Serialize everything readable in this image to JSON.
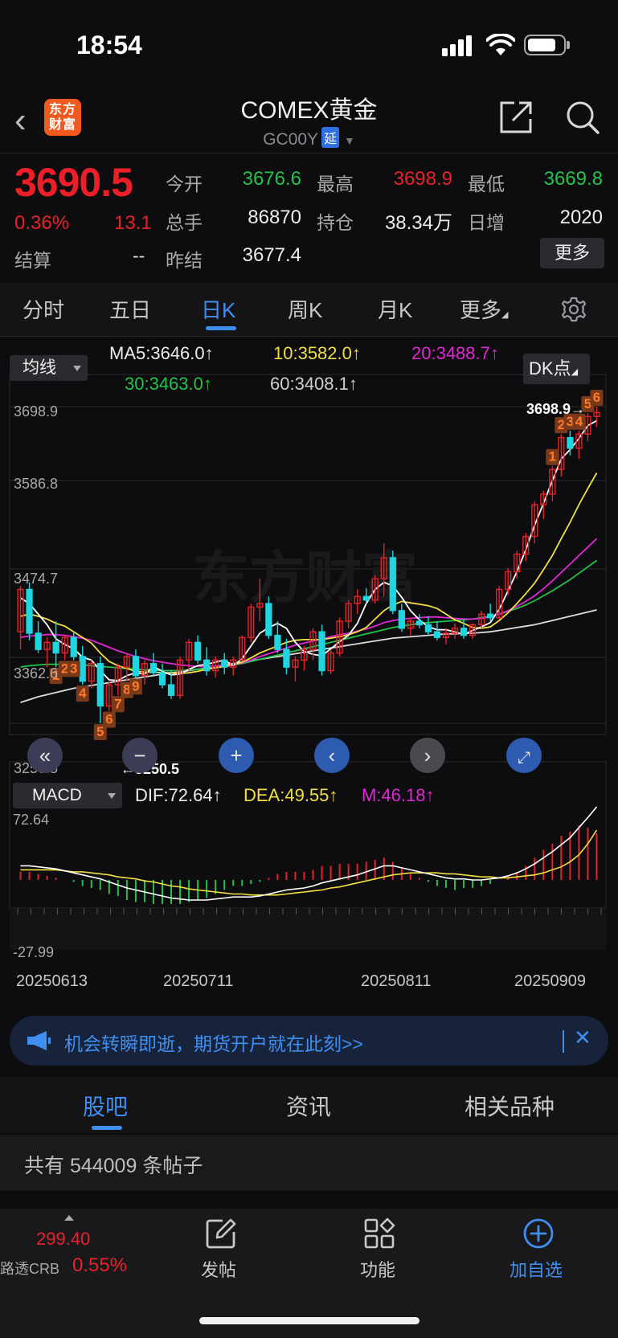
{
  "status_bar": {
    "time": "18:54"
  },
  "header": {
    "logo_line1": "东方",
    "logo_line2": "财富",
    "title": "COMEX黄金",
    "code": "GC00Y",
    "delay_badge": "延"
  },
  "quote": {
    "price": "3690.5",
    "change_pct": "0.36%",
    "change": "13.1",
    "settle_label": "结算",
    "settle_value": "--",
    "open_label": "今开",
    "open_value": "3676.6",
    "high_label": "最高",
    "high_value": "3698.9",
    "low_label": "最低",
    "low_value": "3669.8",
    "volume_label": "总手",
    "volume_value": "86870",
    "oi_label": "持仓",
    "oi_value": "38.34万",
    "daily_inc_label": "日增",
    "daily_inc_value": "2020",
    "prev_settle_label": "昨结",
    "prev_settle_value": "3677.4",
    "more_label": "更多"
  },
  "tabs": [
    "分时",
    "五日",
    "日K",
    "周K",
    "月K",
    "更多"
  ],
  "active_tab": "日K",
  "indicators": {
    "ma_select": "均线",
    "ma5": "MA5:3646.0↑",
    "ma10": "10:3582.0↑",
    "ma20": "20:3488.7↑",
    "ma30": "30:3463.0↑",
    "ma60": "60:3408.1↑",
    "dk_label": "DK点",
    "macd_select": "MACD",
    "dif": "DIF:72.64↑",
    "dea": "DEA:49.55↑",
    "m": "M:46.18↑"
  },
  "axis": {
    "y_labels": [
      "3698.9",
      "3586.8",
      "3474.7",
      "3362.6",
      "3250.5"
    ],
    "max_marker": "3698.9→",
    "min_marker": "←3250.5",
    "macd_top": "72.64",
    "macd_bottom": "-27.99",
    "dates": [
      "20250613",
      "20250711",
      "20250811",
      "20250909"
    ]
  },
  "colors": {
    "up": "#e8212a",
    "down": "#1fd5e0",
    "ma5": "#ffffff",
    "ma10": "#f3df41",
    "ma20": "#e126d6",
    "ma30": "#22c34a",
    "ma60": "#dddddd",
    "accent": "#3f8ff2"
  },
  "chart_data": {
    "type": "candlestick",
    "ylim": [
      3250.5,
      3698.9
    ],
    "candles": [
      [
        3380,
        3445,
        3355,
        3440
      ],
      [
        3440,
        3450,
        3368,
        3378
      ],
      [
        3378,
        3395,
        3350,
        3355
      ],
      [
        3355,
        3372,
        3330,
        3365
      ],
      [
        3365,
        3395,
        3330,
        3350
      ],
      [
        3350,
        3375,
        3340,
        3372
      ],
      [
        3372,
        3380,
        3340,
        3345
      ],
      [
        3345,
        3360,
        3305,
        3310
      ],
      [
        3310,
        3340,
        3300,
        3335
      ],
      [
        3335,
        3345,
        3250.5,
        3275
      ],
      [
        3275,
        3310,
        3268,
        3305
      ],
      [
        3305,
        3335,
        3290,
        3330
      ],
      [
        3330,
        3350,
        3310,
        3345
      ],
      [
        3345,
        3355,
        3315,
        3318
      ],
      [
        3318,
        3340,
        3305,
        3335
      ],
      [
        3335,
        3350,
        3318,
        3322
      ],
      [
        3322,
        3335,
        3300,
        3305
      ],
      [
        3305,
        3325,
        3285,
        3290
      ],
      [
        3290,
        3345,
        3285,
        3340
      ],
      [
        3340,
        3370,
        3325,
        3365
      ],
      [
        3365,
        3375,
        3335,
        3340
      ],
      [
        3340,
        3358,
        3318,
        3325
      ],
      [
        3325,
        3345,
        3315,
        3340
      ],
      [
        3340,
        3350,
        3320,
        3330
      ],
      [
        3330,
        3345,
        3318,
        3340
      ],
      [
        3340,
        3375,
        3338,
        3372
      ],
      [
        3372,
        3420,
        3365,
        3415
      ],
      [
        3415,
        3455,
        3395,
        3420
      ],
      [
        3420,
        3430,
        3370,
        3375
      ],
      [
        3375,
        3395,
        3350,
        3355
      ],
      [
        3355,
        3370,
        3320,
        3330
      ],
      [
        3330,
        3345,
        3310,
        3340
      ],
      [
        3340,
        3360,
        3325,
        3355
      ],
      [
        3355,
        3385,
        3340,
        3380
      ],
      [
        3380,
        3390,
        3318,
        3325
      ],
      [
        3325,
        3355,
        3320,
        3350
      ],
      [
        3350,
        3400,
        3345,
        3395
      ],
      [
        3395,
        3425,
        3385,
        3420
      ],
      [
        3420,
        3440,
        3405,
        3430
      ],
      [
        3430,
        3442,
        3420,
        3425
      ],
      [
        3425,
        3460,
        3420,
        3455
      ],
      [
        3455,
        3505,
        3430,
        3485
      ],
      [
        3485,
        3495,
        3405,
        3410
      ],
      [
        3410,
        3420,
        3380,
        3385
      ],
      [
        3385,
        3400,
        3375,
        3395
      ],
      [
        3395,
        3405,
        3385,
        3390
      ],
      [
        3390,
        3402,
        3375,
        3380
      ],
      [
        3380,
        3395,
        3368,
        3372
      ],
      [
        3372,
        3385,
        3362,
        3378
      ],
      [
        3378,
        3392,
        3370,
        3385
      ],
      [
        3385,
        3398,
        3370,
        3375
      ],
      [
        3375,
        3392,
        3370,
        3390
      ],
      [
        3390,
        3410,
        3385,
        3405
      ],
      [
        3405,
        3420,
        3395,
        3400
      ],
      [
        3400,
        3445,
        3398,
        3440
      ],
      [
        3440,
        3470,
        3432,
        3465
      ],
      [
        3465,
        3495,
        3455,
        3490
      ],
      [
        3490,
        3520,
        3480,
        3515
      ],
      [
        3515,
        3565,
        3505,
        3560
      ],
      [
        3560,
        3580,
        3540,
        3575
      ],
      [
        3575,
        3615,
        3565,
        3610
      ],
      [
        3610,
        3660,
        3600,
        3655
      ],
      [
        3655,
        3665,
        3630,
        3640
      ],
      [
        3640,
        3665,
        3625,
        3660
      ],
      [
        3660,
        3690,
        3650,
        3685
      ],
      [
        3685,
        3698.9,
        3670,
        3690.5
      ]
    ],
    "ma5": [
      3428,
      3420,
      3405,
      3390,
      3370,
      3362,
      3356,
      3344,
      3340,
      3325,
      3312,
      3311,
      3318,
      3322,
      3320,
      3331,
      3324,
      3319,
      3320,
      3327,
      3332,
      3334,
      3337,
      3340,
      3332,
      3342,
      3360,
      3378,
      3386,
      3392,
      3385,
      3365,
      3352,
      3348,
      3346,
      3356,
      3366,
      3375,
      3392,
      3420,
      3440,
      3450,
      3445,
      3429,
      3410,
      3397,
      3387,
      3383,
      3383,
      3380,
      3376,
      3382,
      3387,
      3393,
      3412,
      3438,
      3465,
      3496,
      3531,
      3562,
      3594,
      3625,
      3638,
      3654,
      3672,
      3679
    ],
    "ma10": [
      3402,
      3405,
      3402,
      3398,
      3392,
      3388,
      3380,
      3372,
      3364,
      3350,
      3338,
      3332,
      3328,
      3324,
      3323,
      3323,
      3322,
      3322,
      3321,
      3322,
      3324,
      3327,
      3329,
      3331,
      3333,
      3337,
      3343,
      3350,
      3355,
      3360,
      3365,
      3368,
      3369,
      3369,
      3369,
      3371,
      3373,
      3376,
      3380,
      3386,
      3398,
      3410,
      3418,
      3423,
      3421,
      3419,
      3417,
      3413,
      3405,
      3397,
      3392,
      3386,
      3385,
      3387,
      3396,
      3407,
      3420,
      3434,
      3449,
      3468,
      3488,
      3512,
      3535,
      3560,
      3583,
      3605
    ],
    "ma20": [
      3372,
      3374,
      3375,
      3376,
      3376,
      3375,
      3373,
      3371,
      3368,
      3363,
      3358,
      3353,
      3349,
      3345,
      3342,
      3339,
      3337,
      3335,
      3333,
      3332,
      3331,
      3331,
      3331,
      3332,
      3333,
      3336,
      3340,
      3345,
      3349,
      3353,
      3357,
      3361,
      3364,
      3367,
      3370,
      3373,
      3376,
      3378,
      3381,
      3384,
      3388,
      3393,
      3396,
      3398,
      3399,
      3400,
      3401,
      3401,
      3400,
      3399,
      3398,
      3398,
      3399,
      3401,
      3405,
      3410,
      3416,
      3423,
      3431,
      3441,
      3452,
      3464,
      3476,
      3488,
      3500,
      3512
    ],
    "ma30": [
      3330,
      3332,
      3333,
      3334,
      3334,
      3334,
      3334,
      3333,
      3332,
      3331,
      3330,
      3329,
      3328,
      3327,
      3326,
      3326,
      3325,
      3325,
      3325,
      3326,
      3327,
      3328,
      3330,
      3331,
      3333,
      3335,
      3338,
      3341,
      3344,
      3347,
      3350,
      3353,
      3356,
      3359,
      3362,
      3365,
      3368,
      3371,
      3374,
      3377,
      3380,
      3383,
      3386,
      3388,
      3390,
      3392,
      3393,
      3394,
      3395,
      3396,
      3397,
      3398,
      3400,
      3402,
      3405,
      3409,
      3413,
      3418,
      3424,
      3431,
      3438,
      3446,
      3454,
      3463,
      3472,
      3481
    ],
    "ma60": [
      3280,
      3284,
      3288,
      3291,
      3294,
      3297,
      3300,
      3302,
      3304,
      3306,
      3308,
      3310,
      3312,
      3314,
      3316,
      3318,
      3320,
      3322,
      3323,
      3325,
      3327,
      3329,
      3331,
      3333,
      3335,
      3337,
      3339,
      3341,
      3343,
      3345,
      3347,
      3349,
      3351,
      3353,
      3355,
      3357,
      3359,
      3361,
      3363,
      3365,
      3367,
      3369,
      3371,
      3372,
      3373,
      3374,
      3375,
      3376,
      3377,
      3377,
      3378,
      3378,
      3379,
      3380,
      3382,
      3384,
      3386,
      3388,
      3390,
      3393,
      3396,
      3399,
      3402,
      3405,
      3408,
      3411
    ],
    "td_labels": [
      [
        "1",
        4
      ],
      [
        "2",
        5
      ],
      [
        "3",
        6
      ],
      [
        "4",
        7
      ],
      [
        "5",
        9
      ],
      [
        "6",
        10
      ],
      [
        "7",
        11
      ],
      [
        "8",
        12
      ],
      [
        "9",
        13
      ],
      [
        "1",
        60
      ],
      [
        "2",
        61
      ],
      [
        "3",
        62
      ],
      [
        "4",
        63
      ],
      [
        "5",
        64
      ],
      [
        "6",
        65
      ]
    ],
    "dif": [
      14,
      14,
      13,
      12,
      11,
      9,
      7,
      5,
      3,
      1,
      -2,
      -5,
      -8,
      -10,
      -12,
      -14,
      -16,
      -18,
      -19,
      -20,
      -20,
      -20,
      -19,
      -18,
      -17,
      -17,
      -17,
      -16,
      -14,
      -12,
      -10,
      -9,
      -8,
      -6,
      -3,
      -1,
      1,
      3,
      5,
      8,
      11,
      14,
      14,
      12,
      10,
      8,
      6,
      4,
      2,
      1,
      1,
      0,
      0,
      1,
      2,
      4,
      7,
      11,
      16,
      22,
      28,
      35,
      42,
      52,
      62,
      72.64
    ],
    "dea": [
      10,
      10,
      10,
      10,
      10,
      9,
      8,
      8,
      7,
      6,
      5,
      3,
      2,
      1,
      -1,
      -2,
      -4,
      -6,
      -7,
      -9,
      -10,
      -11,
      -12,
      -13,
      -14,
      -14,
      -15,
      -15,
      -15,
      -15,
      -14,
      -13,
      -12,
      -11,
      -10,
      -8,
      -7,
      -5,
      -3,
      -1,
      1,
      3,
      5,
      6,
      7,
      7,
      7,
      7,
      6,
      6,
      5,
      4,
      3,
      3,
      2,
      2,
      3,
      4,
      5,
      7,
      10,
      13,
      18,
      25,
      36,
      49.55
    ],
    "macd": [
      8,
      8,
      6,
      4,
      2,
      0,
      -2,
      -6,
      -8,
      -10,
      -14,
      -16,
      -20,
      -22,
      -22,
      -24,
      -24,
      -24,
      -24,
      -22,
      -20,
      -18,
      -14,
      -10,
      -6,
      -6,
      -4,
      -2,
      2,
      6,
      8,
      8,
      8,
      10,
      14,
      14,
      16,
      16,
      16,
      18,
      20,
      22,
      18,
      12,
      6,
      2,
      -2,
      -6,
      -8,
      -10,
      -8,
      -8,
      -6,
      -4,
      0,
      4,
      8,
      14,
      22,
      30,
      36,
      44,
      48,
      54,
      52,
      46.18
    ]
  },
  "banner": {
    "text": "机会转瞬即逝，期货开户就在此刻>>"
  },
  "sub_tabs": [
    "股吧",
    "资讯",
    "相关品种"
  ],
  "posts": {
    "text": "共有 544009 条帖子"
  },
  "bottom_bar": {
    "crb_value": "299.40",
    "crb_name": "路透CRB",
    "crb_pct": "0.55%",
    "post_label": "发帖",
    "func_label": "功能",
    "watch_label": "加自选"
  }
}
